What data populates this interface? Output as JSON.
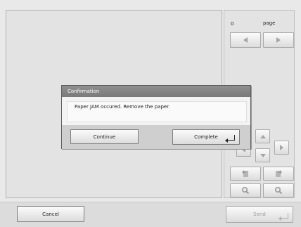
{
  "page_counter": {
    "value": "0",
    "label": "page"
  },
  "dialog": {
    "title": "Confirmation",
    "message": "Paper JAM occured. Remove the paper.",
    "continue_label": "Continue",
    "complete_label": "Complete"
  },
  "footer": {
    "cancel_label": "Cancel",
    "send_label": "Send"
  }
}
